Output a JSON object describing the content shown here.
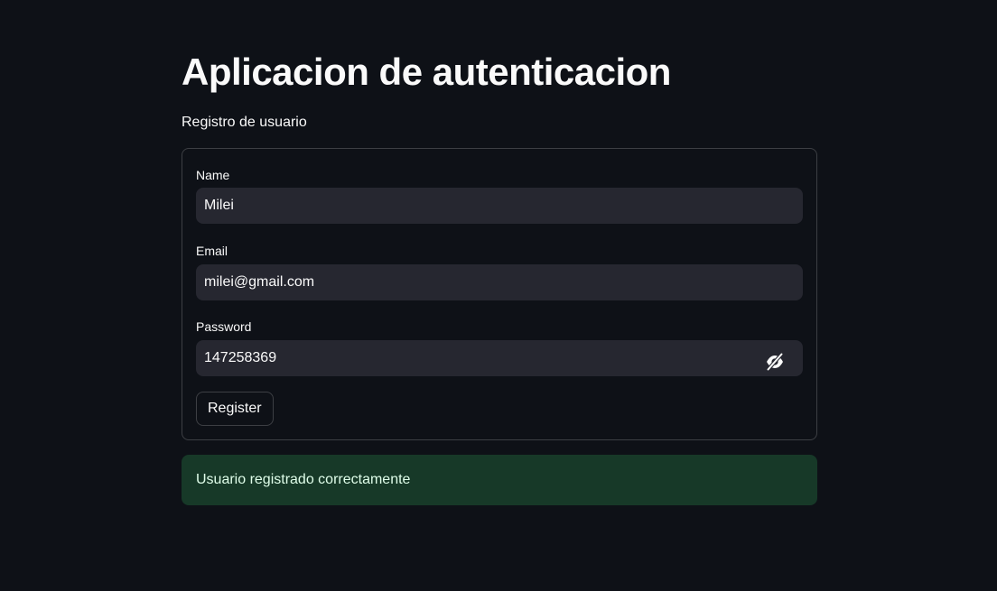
{
  "app": {
    "title": "Aplicacion de autenticacion",
    "subtitle": "Registro de usuario"
  },
  "form": {
    "name": {
      "label": "Name",
      "value": "Milei"
    },
    "email": {
      "label": "Email",
      "value": "milei@gmail.com"
    },
    "password": {
      "label": "Password",
      "value": "147258369",
      "toggle_icon": "eye-slash-icon"
    },
    "submit_label": "Register"
  },
  "status": {
    "message": "Usuario registrado correctamente",
    "kind": "success"
  },
  "colors": {
    "background": "#0e1117",
    "input_background": "#262730",
    "success_background": "#173928",
    "success_text": "#dffde9"
  }
}
